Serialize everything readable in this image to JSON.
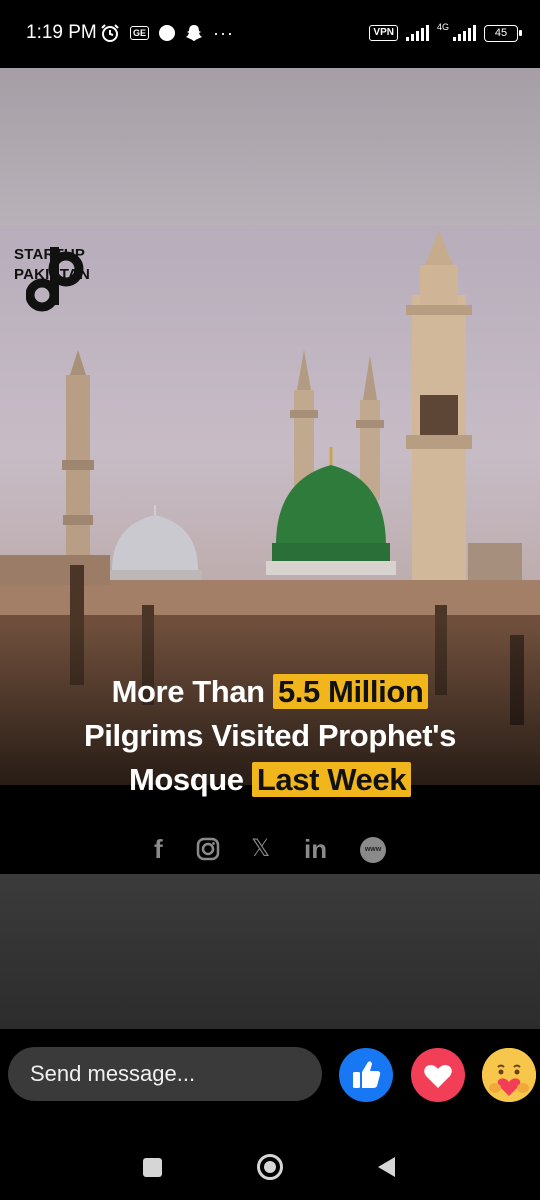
{
  "status_bar": {
    "time": "1:19 PM",
    "left_icons": [
      "alarm-icon",
      "ge-icon",
      "circle-icon",
      "snapchat-icon",
      "more-dots-icon"
    ],
    "ge_label": "GE",
    "vpn_label": "VPN",
    "network_type": "4G",
    "battery_level": "45"
  },
  "post": {
    "logo_line1": "STARTUP",
    "logo_line2": "PAKISTAN",
    "headline_line1_prefix": "More Than ",
    "headline_line1_highlight": "5.5 Million",
    "headline_line2": "Pilgrims Visited Prophet's",
    "headline_line3_prefix": "Mosque ",
    "headline_line3_highlight": "Last Week",
    "highlight_color": "#f2b61d",
    "social_icons": [
      "facebook-icon",
      "instagram-icon",
      "x-icon",
      "linkedin-icon",
      "www-icon"
    ],
    "social_labels": {
      "facebook": "f",
      "x": "𝕏",
      "linkedin": "in",
      "www": "www"
    }
  },
  "message_bar": {
    "placeholder": "Send message..."
  },
  "reactions": [
    "like",
    "love",
    "care"
  ],
  "nav": [
    "recent-apps",
    "home",
    "back"
  ]
}
